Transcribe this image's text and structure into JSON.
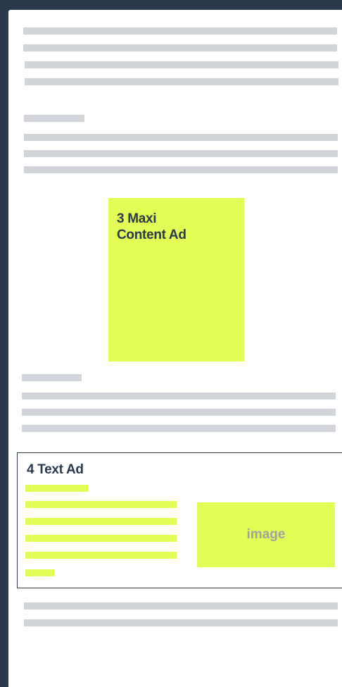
{
  "maxi_ad": {
    "title_line1": "3 Maxi",
    "title_line2": "Content Ad"
  },
  "text_ad": {
    "title": "4 Text Ad",
    "image_label": "image"
  },
  "colors": {
    "frame": "#2a3a4c",
    "page": "#ffffff",
    "placeholder": "#d1d4d9",
    "ad": "#e3fb55",
    "image_text": "#a0a0a0"
  }
}
